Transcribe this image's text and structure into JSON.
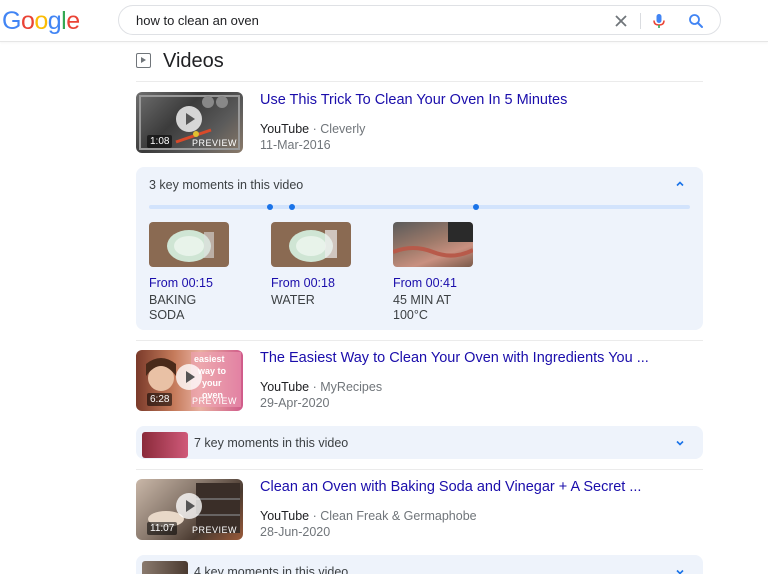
{
  "logo": {
    "letters": [
      "G",
      "o",
      "o",
      "g",
      "l",
      "e"
    ],
    "colors": [
      "#4285f4",
      "#ea4335",
      "#fbbc05",
      "#4285f4",
      "#34a853",
      "#ea4335"
    ]
  },
  "search": {
    "query": "how to clean an oven"
  },
  "section": {
    "title": "Videos"
  },
  "videos": [
    {
      "title": "Use This Trick To Clean Your Oven In 5 Minutes",
      "source": "YouTube",
      "channel": "Cleverly",
      "date": "11-Mar-2016",
      "duration": "1:08",
      "preview": "PREVIEW",
      "key_moments": {
        "label": "3 key moments in this video",
        "expanded": true,
        "moments": [
          {
            "from": "From 00:15",
            "desc": "BAKING\nSODA"
          },
          {
            "from": "From 00:18",
            "desc": "WATER"
          },
          {
            "from": "From 00:41",
            "desc": "45 MIN AT\n100°C"
          }
        ]
      }
    },
    {
      "title": "The Easiest Way to Clean Your Oven with Ingredients You ...",
      "source": "YouTube",
      "channel": "MyRecipes",
      "date": "29-Apr-2020",
      "duration": "6:28",
      "preview": "PREVIEW",
      "key_moments": {
        "label": "7 key moments in this video",
        "expanded": false
      }
    },
    {
      "title": "Clean an Oven with Baking Soda and Vinegar + A Secret ...",
      "source": "YouTube",
      "channel": "Clean Freak & Germaphobe",
      "date": "28-Jun-2020",
      "duration": "11:07",
      "preview": "PREVIEW",
      "key_moments": {
        "label": "4 key moments in this video",
        "expanded": false
      }
    }
  ],
  "separator": "·",
  "colors": {
    "link": "#1a0dab",
    "accent": "#1a73e8",
    "panel": "#eef3fb"
  }
}
